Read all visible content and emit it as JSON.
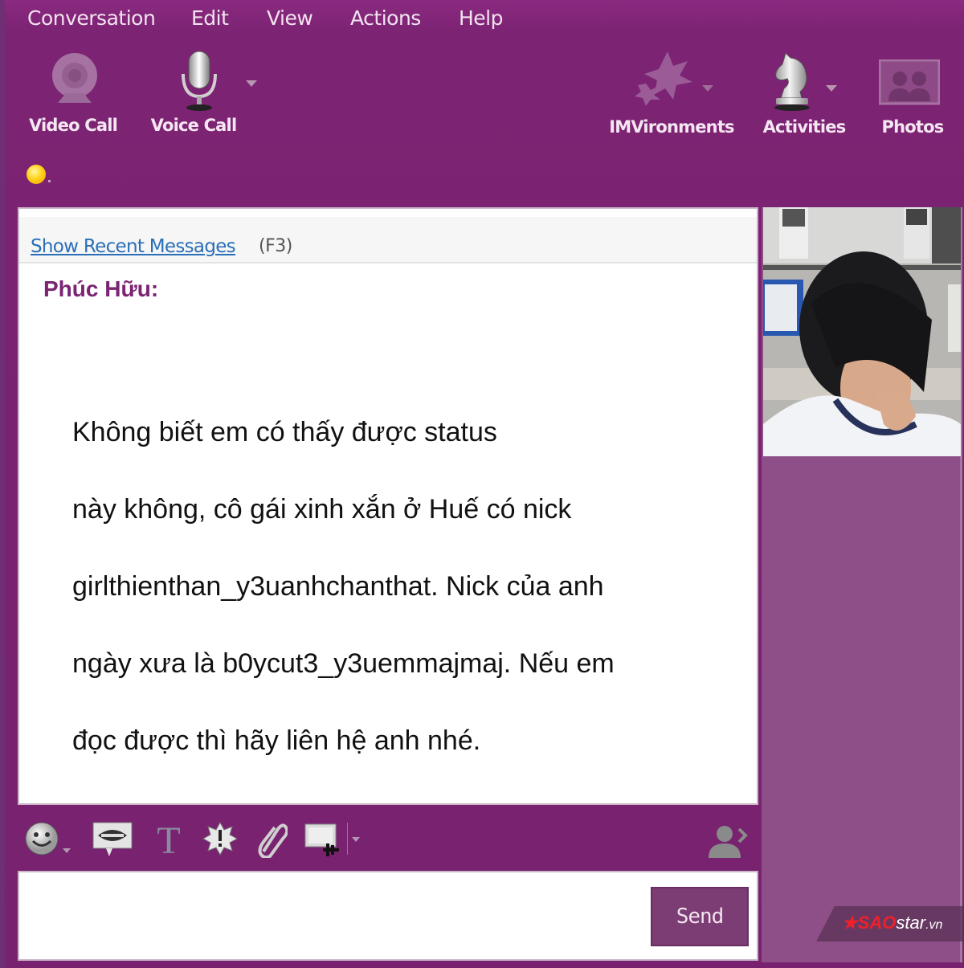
{
  "menu": [
    "Conversation",
    "Edit",
    "View",
    "Actions",
    "Help"
  ],
  "toolbar": {
    "video_call": "Video Call",
    "voice_call": "Voice Call",
    "imvironments": "IMVironments",
    "activities": "Activities",
    "photos": "Photos"
  },
  "chat": {
    "show_recent_link": "Show Recent Messages",
    "show_recent_shortcut": "(F3)",
    "sender": "Phúc Hữu:",
    "message_lines": [
      "Không biết em có thấy được status",
      "này không, cô gái xinh xắn ở Huế có nick",
      "girlthienthan_y3uanhchanthat. Nick của anh",
      "ngày xưa là b0ycut3_y3uemmajmaj. Nếu em",
      "đọc được thì hãy liên hệ anh nhé."
    ]
  },
  "formatting_toolbar": {
    "icons": [
      "emoticon-icon",
      "audible-icon",
      "text-format-icon",
      "buzz-icon",
      "attach-icon",
      "screenshot-icon"
    ]
  },
  "input": {
    "value": "",
    "placeholder": "",
    "send_label": "Send"
  },
  "watermark": {
    "brand_red": "SAO",
    "brand_white": "star",
    "domain": ".vn"
  },
  "colors": {
    "window_bg": "#7c2373",
    "side_panel": "#8e4f88",
    "sender_name": "#7a2472",
    "link": "#2a6fb8"
  }
}
